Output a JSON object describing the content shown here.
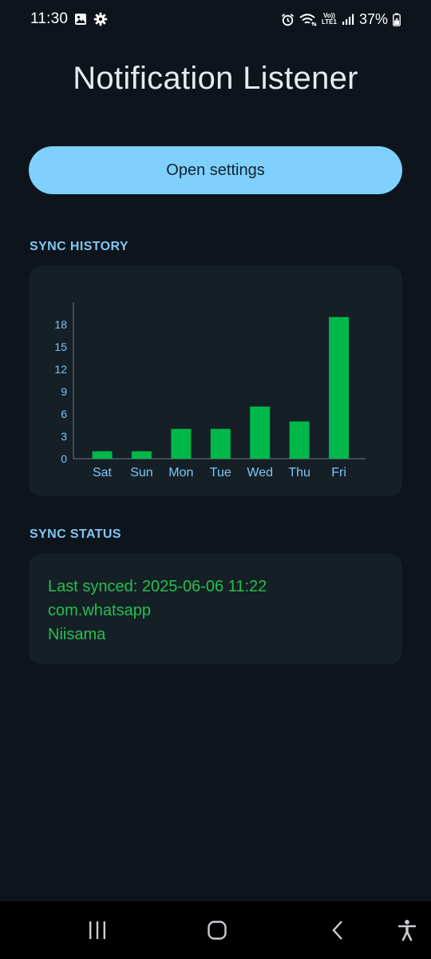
{
  "status_bar": {
    "time": "11:30",
    "battery": "37%",
    "left_icons": [
      "image-icon",
      "settings-gear-icon"
    ],
    "right_icons": [
      "alarm-icon",
      "wifi-icon",
      "volte-icon",
      "signal-icon",
      "battery-icon"
    ],
    "volte_top": "Vo))",
    "volte_bottom": "LTE1"
  },
  "header": {
    "title": "Notification Listener"
  },
  "actions": {
    "open_settings_label": "Open settings"
  },
  "sync_history": {
    "section_label": "SYNC HISTORY"
  },
  "chart_data": {
    "type": "bar",
    "title": "",
    "xlabel": "",
    "ylabel": "",
    "categories": [
      "Sat",
      "Sun",
      "Mon",
      "Tue",
      "Wed",
      "Thu",
      "Fri"
    ],
    "values": [
      1,
      1,
      4,
      4,
      7,
      5,
      19
    ],
    "yticks": [
      0,
      3,
      6,
      9,
      12,
      15,
      18
    ],
    "ylim": [
      0,
      21
    ],
    "grid": false,
    "bar_color": "#00b849",
    "tick_label_color": "#7fc7f5"
  },
  "sync_status": {
    "section_label": "SYNC STATUS",
    "lines": [
      "Last synced: 2025-06-06 11:22",
      "com.whatsapp",
      "Niisama"
    ],
    "text_color": "#27c04e"
  },
  "nav_bar": {
    "icons": [
      "recents-icon",
      "home-icon",
      "back-icon",
      "accessibility-icon"
    ]
  },
  "colors": {
    "background": "#0d141b",
    "card": "#141f26",
    "accent": "#7fd0fd",
    "section_label": "#7fc7f5"
  }
}
